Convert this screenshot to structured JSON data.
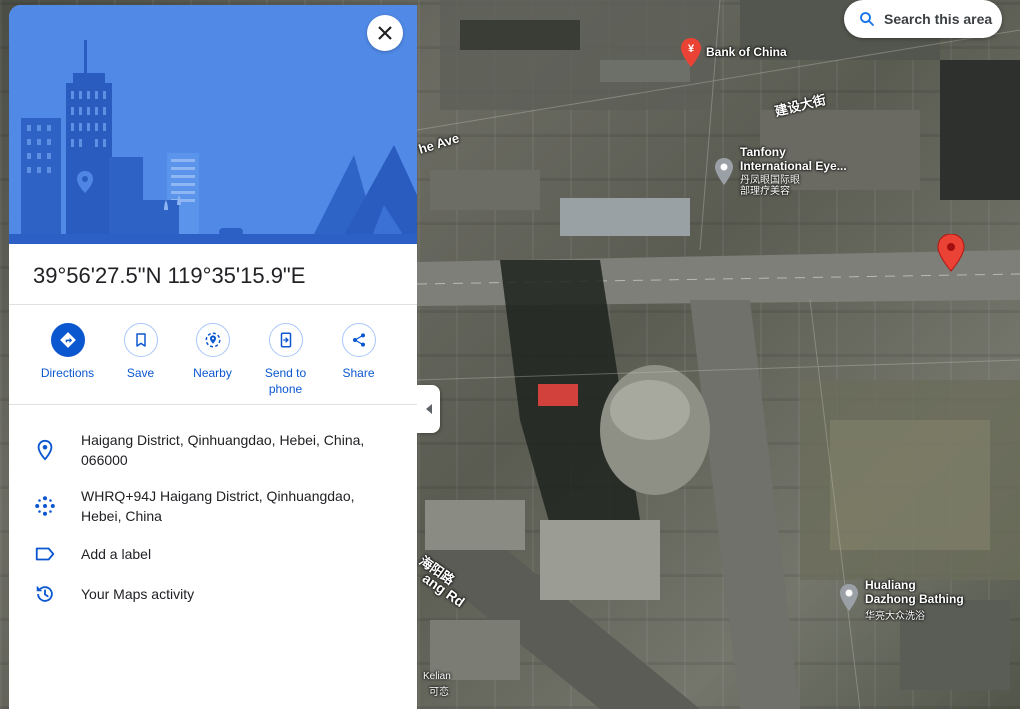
{
  "panel": {
    "coordinates": "39°56'27.5\"N 119°35'15.9\"E",
    "actions": [
      {
        "label": "Directions",
        "icon": "directions-icon"
      },
      {
        "label": "Save",
        "icon": "bookmark-icon"
      },
      {
        "label": "Nearby",
        "icon": "nearby-icon"
      },
      {
        "label": "Send to phone",
        "icon": "send-to-phone-icon"
      },
      {
        "label": "Share",
        "icon": "share-icon"
      }
    ],
    "info": [
      {
        "text": "Haigang District, Qinhuangdao, Hebei, China, 066000",
        "icon": "location-pin-icon"
      },
      {
        "text": "WHRQ+94J Haigang District, Qinhuangdao, Hebei, China",
        "icon": "plus-code-icon"
      },
      {
        "text": "Add a label",
        "icon": "label-icon"
      },
      {
        "text": "Your Maps activity",
        "icon": "history-icon"
      }
    ]
  },
  "map": {
    "search_this_area": "Search this area",
    "places": {
      "bank": "Bank of China",
      "tanfony": "Tanfony\nInternational Eye...",
      "tanfony_cn": "丹凤眼国际眼\n部理疗美容",
      "hualiang": "Hualiang\nDazhong Bathing",
      "hualiang_cn": "华亮大众洗浴",
      "kelian": "Kelian",
      "kelian_cn": "可恋"
    },
    "roads": {
      "top_ave": "he Ave",
      "jianshe": "建设大街",
      "haiyang_cn": "海阳路",
      "haiyang": "ang Rd"
    }
  },
  "colors": {
    "accent": "#0b57d0",
    "hero_bg": "#4e86e6",
    "pin_red": "#ea4335"
  }
}
